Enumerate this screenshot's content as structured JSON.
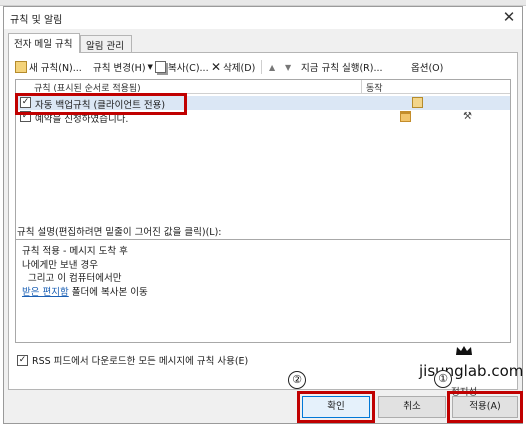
{
  "dialog": {
    "title": "규칙 및 알림",
    "close_glyph": "✕"
  },
  "tabs": [
    {
      "label": "전자 메일 규칙"
    },
    {
      "label": "알림 관리"
    }
  ],
  "toolbar": {
    "new_rule": "새 규칙(N)...",
    "change_rule": "규칙 변경(H)",
    "copy": "복사(C)...",
    "delete": "삭제(D)",
    "run_rules": "지금 규칙 실행(R)...",
    "options": "옵션(O)"
  },
  "rules_list": {
    "columns": [
      "규칙 (표시된 순서로 적용됨)",
      "동작"
    ],
    "rows": [
      {
        "label": "자동 백업규칙 (클라이언트 전용)",
        "checked": true,
        "selected": true
      },
      {
        "label": "예약을 신청하였습니다.",
        "checked": true,
        "selected": false
      }
    ]
  },
  "description": {
    "label": "규칙 설명(편집하려면 밑줄이 그어진 값을 클릭)(L):",
    "lines": [
      "규칙 적용 - 메시지 도착 후",
      "나에게만 보낸 경우",
      "그리고 이 컴퓨터에서만",
      "폴더에 복사본 이동"
    ],
    "link_text": "받은 편지함"
  },
  "rss_option": {
    "label": "RSS 피드에서 다운로드한 모든 메시지에 규칙 사용(E)",
    "checked": true
  },
  "buttons": {
    "ok": "확인",
    "cancel": "취소",
    "apply": "적용(A)"
  },
  "watermark": {
    "site": "jisunglab.com",
    "name": "정지성"
  },
  "steps": [
    "①",
    "②"
  ],
  "colors": {
    "highlight_box": "#c00000",
    "selection": "#dbe7f5",
    "link": "#1a5fb4"
  }
}
